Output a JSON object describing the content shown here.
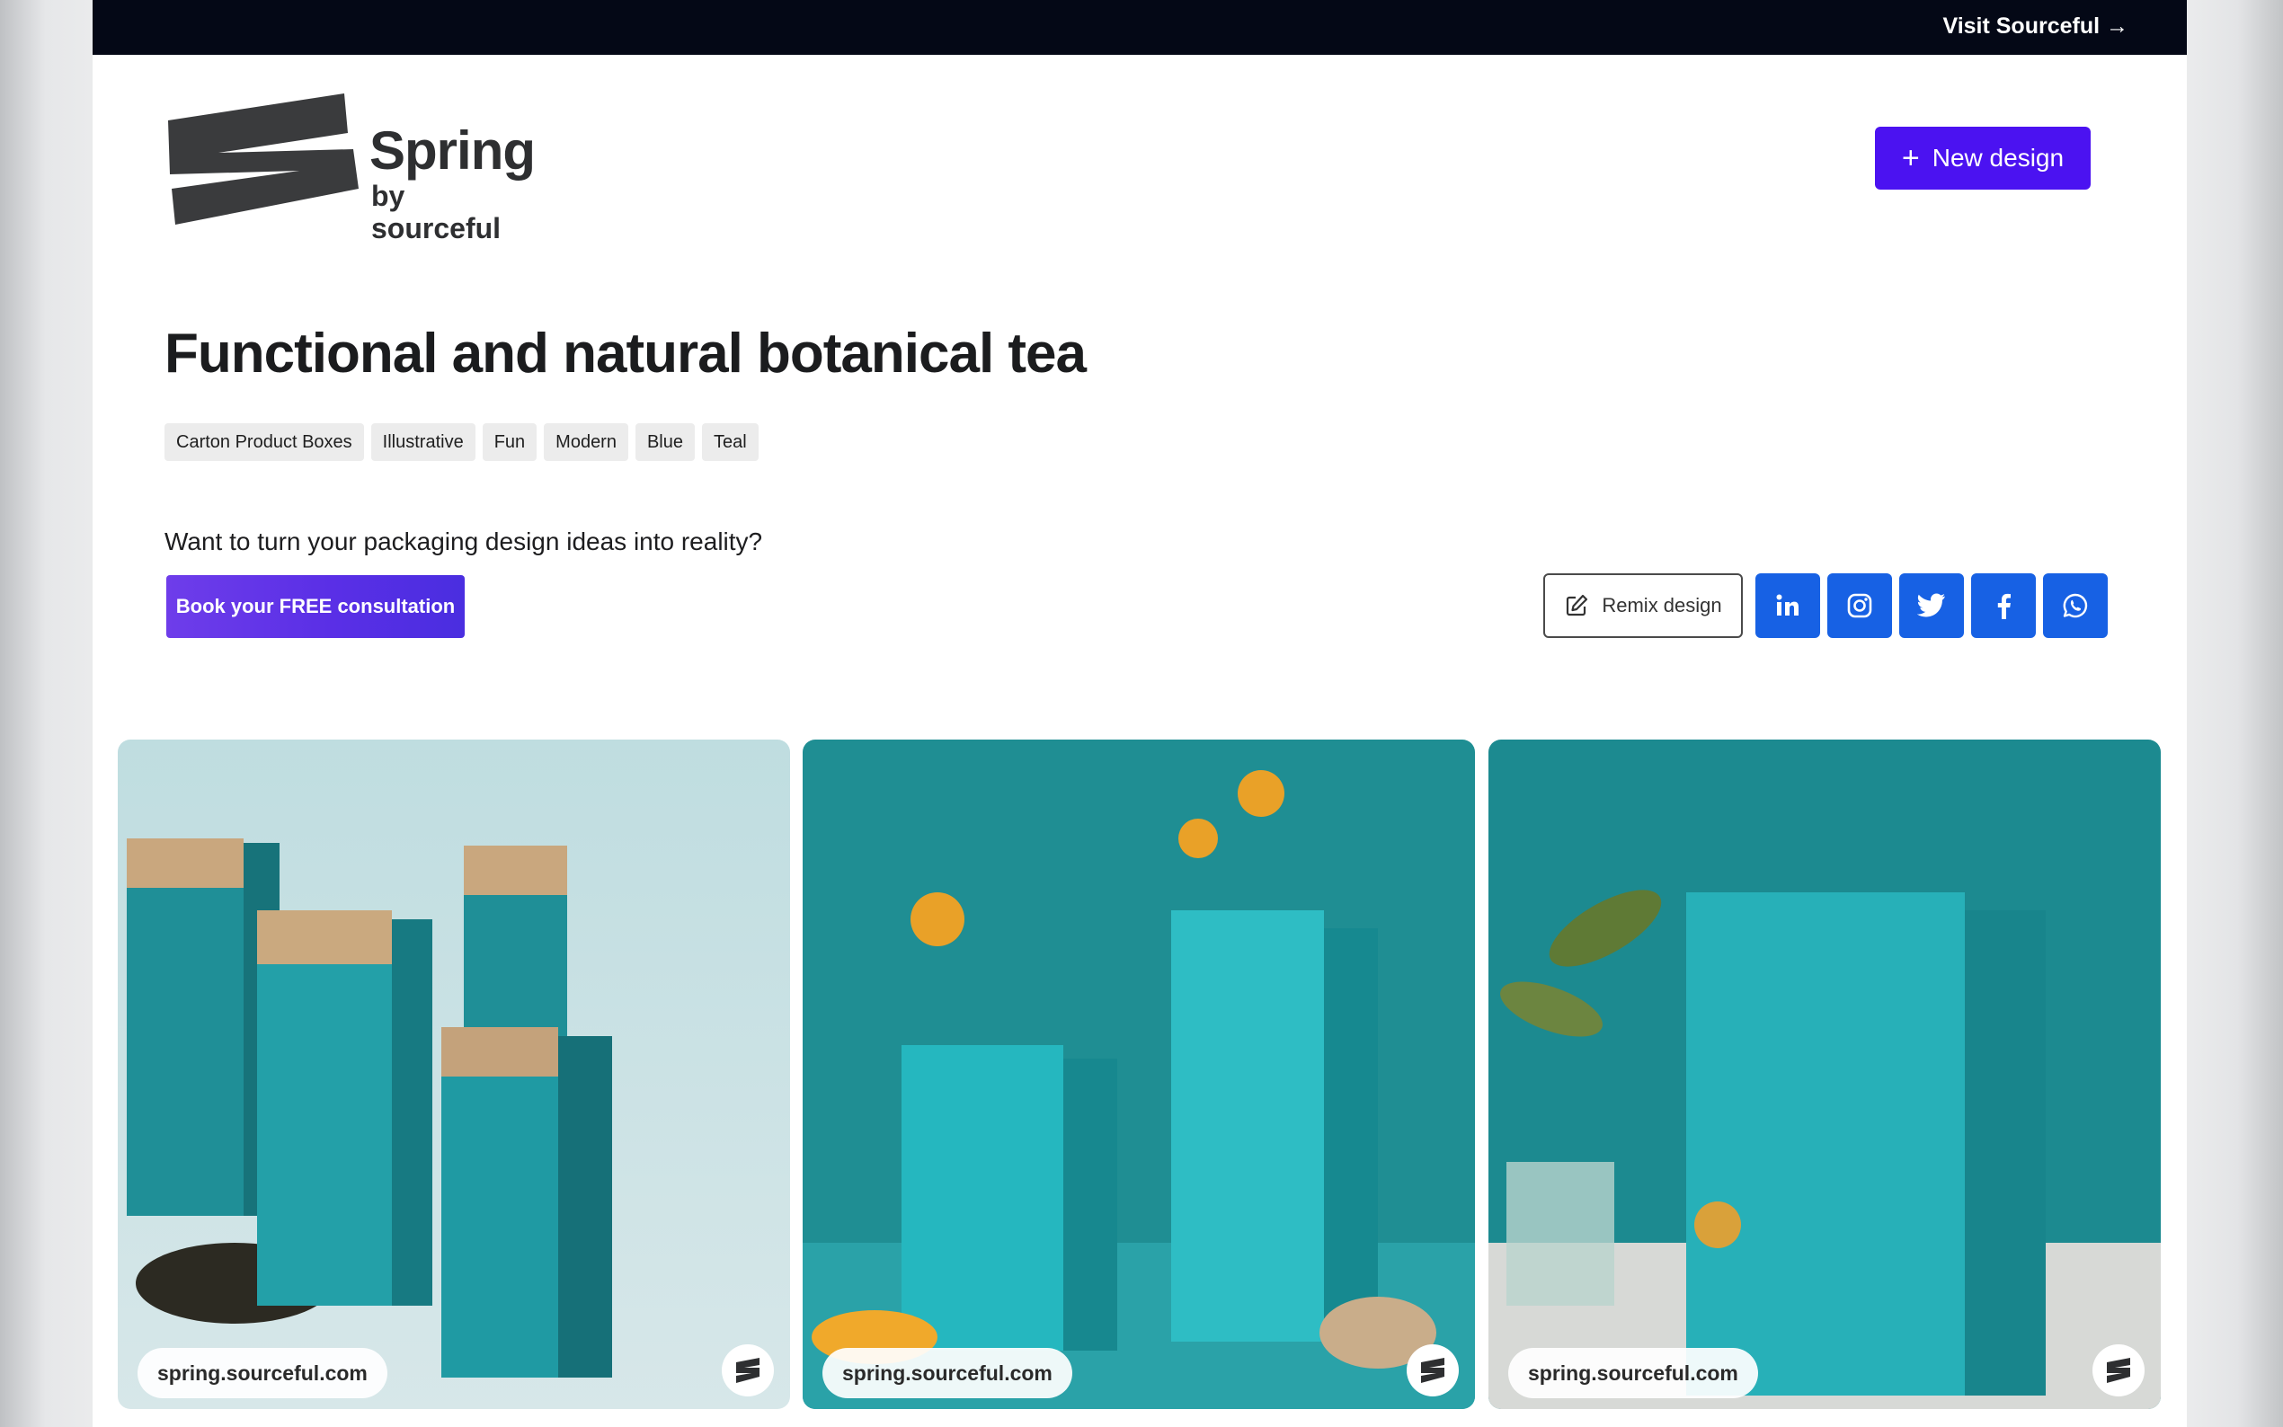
{
  "topbar": {
    "visit_link": "Visit Sourceful →"
  },
  "logo": {
    "word": "Spring",
    "sub": "by sourceful"
  },
  "header": {
    "new_design_label": "New design",
    "new_design_icon": "plus-icon"
  },
  "project": {
    "title": "Functional and natural botanical tea",
    "tags": [
      "Carton Product Boxes",
      "Illustrative",
      "Fun",
      "Modern",
      "Blue",
      "Teal"
    ]
  },
  "cta": {
    "question": "Want to turn your packaging design ideas into reality?",
    "consult_label": "Book your FREE consultation"
  },
  "actions": {
    "remix_label": "Remix design",
    "remix_icon": "edit-icon",
    "social": [
      {
        "name": "linkedin-icon"
      },
      {
        "name": "instagram-icon"
      },
      {
        "name": "twitter-icon"
      },
      {
        "name": "facebook-icon"
      },
      {
        "name": "whatsapp-icon"
      }
    ]
  },
  "gallery": {
    "cards": [
      {
        "url": "spring.sourceful.com"
      },
      {
        "url": "spring.sourceful.com"
      },
      {
        "url": "spring.sourceful.com"
      }
    ]
  },
  "colors": {
    "accent": "#4b12f1",
    "social": "#1761e4",
    "topbar": "#040816",
    "teal": "#1e9fa8"
  }
}
